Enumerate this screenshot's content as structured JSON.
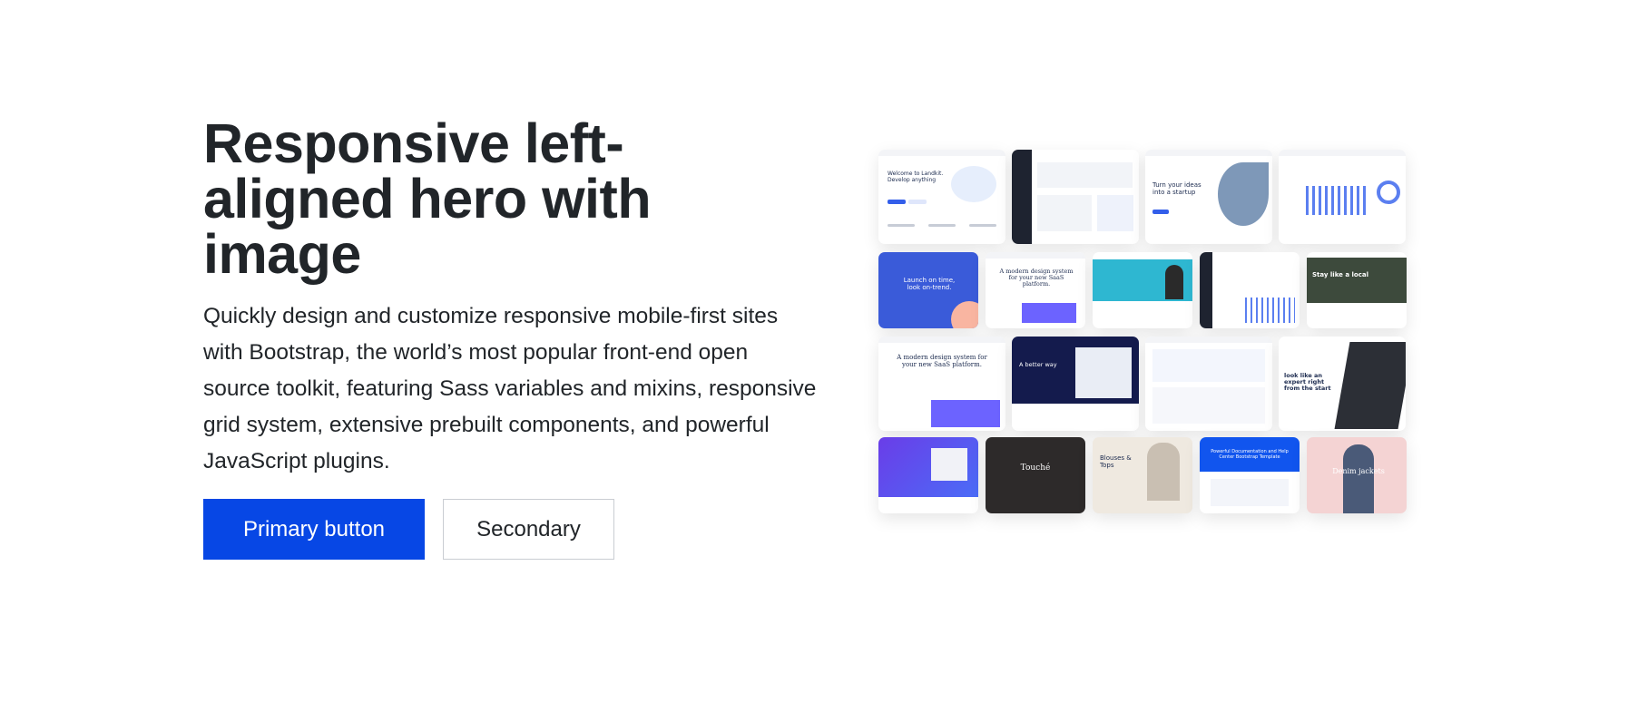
{
  "hero": {
    "title": "Responsive left-aligned hero with image",
    "lead": "Quickly design and customize responsive mobile-first sites with Bootstrap, the world’s most popular front-end open source toolkit, featuring Sass variables and mixins, responsive grid system, extensive prebuilt components, and powerful JavaScript plugins.",
    "primary_button": "Primary button",
    "secondary_button": "Secondary"
  },
  "collage": {
    "tiles": {
      "landkit": "Welcome to Landkit. Develop anything",
      "startup": "Turn your ideas into a startup",
      "launch": "Launch on time, look on-trend.",
      "saas1": "A modern design system for your new SaaS platform.",
      "level": "Stay like a local",
      "saas2": "A modern design system for your new SaaS platform.",
      "better_way": "A better way",
      "expert": "look like an expert right from the start",
      "touche": "Touché",
      "blouses": "Blouses & Tops",
      "docs": "Powerful Documentation and Help Center Bootstrap Template",
      "denim": "Denim jackets"
    }
  },
  "colors": {
    "primary": "#0747e5",
    "text": "#212529",
    "secondary_border": "#c9cdd2"
  }
}
